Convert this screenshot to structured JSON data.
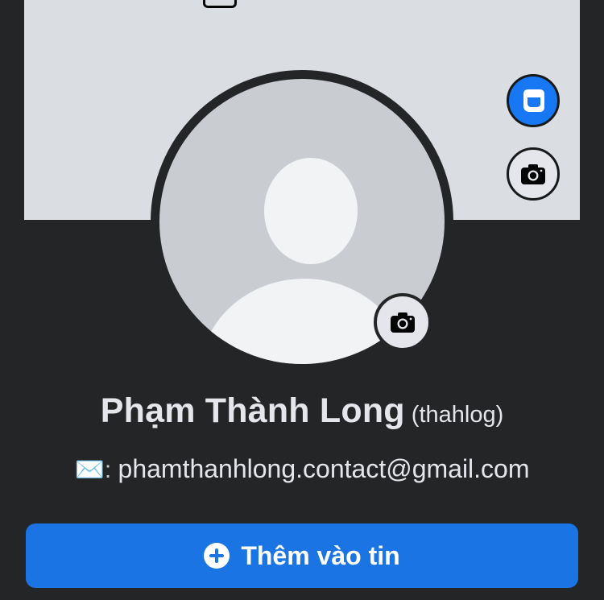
{
  "profile": {
    "name": "Phạm Thành Long",
    "nickname": "(thahlog)",
    "email_prefix": "✉️: ",
    "email": "phamthanhlong.contact@gmail.com"
  },
  "actions": {
    "add_story_label": "Thêm vào tin"
  },
  "icons": {
    "avatar": "avatar-icon",
    "cover_camera": "camera-icon",
    "profile_camera": "camera-icon",
    "add_story": "plus-circle-icon",
    "email": "envelope-icon"
  },
  "colors": {
    "background": "#242526",
    "cover": "#dadde1",
    "accent": "#1b74e4",
    "text": "#e4e6eb"
  }
}
